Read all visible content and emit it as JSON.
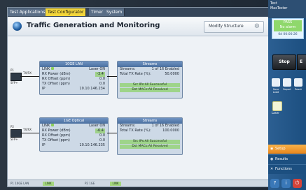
{
  "tabs": [
    {
      "label": "Test Applications",
      "active": false
    },
    {
      "label": "Test Configurator",
      "active": true
    },
    {
      "label": "Timer",
      "active": false
    },
    {
      "label": "System",
      "active": false
    }
  ],
  "header": {
    "title": "Traffic Generation and Monitoring",
    "modify_label": "Modify Structure"
  },
  "ports": [
    {
      "port_label": "P1",
      "port_type": "SFP+",
      "link_dir": "TX/RX",
      "interface": {
        "title": "10GE LAN",
        "link_label": "LINK",
        "laser_label": "Laser ON",
        "rows": [
          {
            "label": "RX Power (dBm)",
            "value": "-3.4"
          },
          {
            "label": "RX Offset (ppm)",
            "value": "0.0"
          },
          {
            "label": "TX Offset (ppm)",
            "value": "0.0"
          },
          {
            "label": "IP",
            "value": "10.10.146.234"
          }
        ]
      },
      "streams": {
        "title": "Streams",
        "rows": [
          {
            "label": "Streams:",
            "value": "1 of 16 Enabled"
          },
          {
            "label": "Total TX Rate (%):",
            "value": "50.0000"
          }
        ],
        "status": [
          "Src IPs:All Successful",
          "Dst MACs:All Resolved"
        ]
      }
    },
    {
      "port_label": "P2",
      "port_type": "SFP+",
      "link_dir": "TX/RX",
      "interface": {
        "title": "1GE Optical",
        "link_label": "LINK",
        "laser_label": "Laser ON",
        "rows": [
          {
            "label": "RX Power (dBm)",
            "value": "-6.4"
          },
          {
            "label": "RX Offset (ppm)",
            "value": "0.0"
          },
          {
            "label": "TX Offset (ppm)",
            "value": "0.0"
          },
          {
            "label": "IP",
            "value": "10.10.146.235"
          }
        ]
      },
      "streams": {
        "title": "Streams",
        "rows": [
          {
            "label": "Streams:",
            "value": "1 of 16 Enabled"
          },
          {
            "label": "Total TX Rate (%):",
            "value": "100.0000"
          }
        ],
        "status": [
          "Src IPs:All Successful",
          "Dst MACs:All Resolved"
        ]
      }
    }
  ],
  "status_bar": [
    {
      "label": "P1 10GE LAN",
      "badge": "LINK"
    },
    {
      "label": "P2 1GE",
      "badge": "LINK"
    }
  ],
  "side": {
    "top_lines": [
      "Test",
      "MaxTester"
    ],
    "pass": "PASS",
    "alarm": "No alarm",
    "duration": "0d 00:00:26",
    "stop": "Stop",
    "exp": "E",
    "tools": [
      {
        "label": "Save Load",
        "icon": "save-icon"
      },
      {
        "label": "Report",
        "icon": "report-icon"
      },
      {
        "label": "Reset",
        "icon": "reset-icon"
      }
    ],
    "laser": "Laser",
    "menu": [
      {
        "label": "Setup",
        "icon": "setup-icon",
        "active": true
      },
      {
        "label": "Results",
        "icon": "results-icon",
        "active": false
      },
      {
        "label": "Functions",
        "icon": "functions-icon",
        "active": false
      }
    ]
  },
  "colors": {
    "active_tab": "#f2d53a",
    "pass": "#8fd86c",
    "status_ok": "#9ed48a",
    "setup_accent": "#e8861d"
  }
}
